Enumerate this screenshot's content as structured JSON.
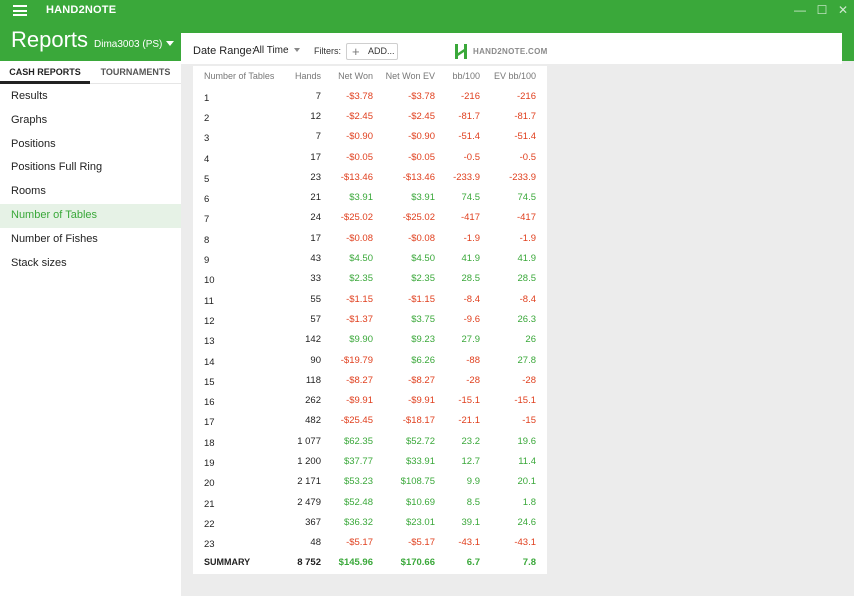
{
  "app": {
    "name": "HAND2NOTE"
  },
  "window_controls": {
    "minimize": "—",
    "maximize": "☐",
    "close": "✕"
  },
  "header": {
    "title": "Reports",
    "account": "Dima3003 (PS)"
  },
  "sidebar": {
    "tabs": [
      {
        "label": "CASH REPORTS",
        "active": true
      },
      {
        "label": "TOURNAMENTS",
        "active": false
      }
    ],
    "items": [
      {
        "label": "Results"
      },
      {
        "label": "Graphs"
      },
      {
        "label": "Positions"
      },
      {
        "label": "Positions Full Ring"
      },
      {
        "label": "Rooms"
      },
      {
        "label": "Number of Tables",
        "active": true
      },
      {
        "label": "Number of Fishes"
      },
      {
        "label": "Stack sizes"
      }
    ]
  },
  "filters": {
    "date_range_label": "Date Range:",
    "date_range_value": "All Time",
    "filters_label": "Filters:",
    "add_label": "ADD..."
  },
  "logo": {
    "text": "HAND2NOTE.COM"
  },
  "table": {
    "headers": [
      "Number of Tables",
      "Hands",
      "Net Won",
      "Net Won  EV",
      "bb/100",
      "EV bb/100"
    ],
    "rows": [
      [
        "1",
        "7",
        "-$3.78",
        "-$3.78",
        "-216",
        "-216"
      ],
      [
        "2",
        "12",
        "-$2.45",
        "-$2.45",
        "-81.7",
        "-81.7"
      ],
      [
        "3",
        "7",
        "-$0.90",
        "-$0.90",
        "-51.4",
        "-51.4"
      ],
      [
        "4",
        "17",
        "-$0.05",
        "-$0.05",
        "-0.5",
        "-0.5"
      ],
      [
        "5",
        "23",
        "-$13.46",
        "-$13.46",
        "-233.9",
        "-233.9"
      ],
      [
        "6",
        "21",
        "$3.91",
        "$3.91",
        "74.5",
        "74.5"
      ],
      [
        "7",
        "24",
        "-$25.02",
        "-$25.02",
        "-417",
        "-417"
      ],
      [
        "8",
        "17",
        "-$0.08",
        "-$0.08",
        "-1.9",
        "-1.9"
      ],
      [
        "9",
        "43",
        "$4.50",
        "$4.50",
        "41.9",
        "41.9"
      ],
      [
        "10",
        "33",
        "$2.35",
        "$2.35",
        "28.5",
        "28.5"
      ],
      [
        "11",
        "55",
        "-$1.15",
        "-$1.15",
        "-8.4",
        "-8.4"
      ],
      [
        "12",
        "57",
        "-$1.37",
        "$3.75",
        "-9.6",
        "26.3"
      ],
      [
        "13",
        "142",
        "$9.90",
        "$9.23",
        "27.9",
        "26"
      ],
      [
        "14",
        "90",
        "-$19.79",
        "$6.26",
        "-88",
        "27.8"
      ],
      [
        "15",
        "118",
        "-$8.27",
        "-$8.27",
        "-28",
        "-28"
      ],
      [
        "16",
        "262",
        "-$9.91",
        "-$9.91",
        "-15.1",
        "-15.1"
      ],
      [
        "17",
        "482",
        "-$25.45",
        "-$18.17",
        "-21.1",
        "-15"
      ],
      [
        "18",
        "1 077",
        "$62.35",
        "$52.72",
        "23.2",
        "19.6"
      ],
      [
        "19",
        "1 200",
        "$37.77",
        "$33.91",
        "12.7",
        "11.4"
      ],
      [
        "20",
        "2 171",
        "$53.23",
        "$108.75",
        "9.9",
        "20.1"
      ],
      [
        "21",
        "2 479",
        "$52.48",
        "$10.69",
        "8.5",
        "1.8"
      ],
      [
        "22",
        "367",
        "$36.32",
        "$23.01",
        "39.1",
        "24.6"
      ],
      [
        "23",
        "48",
        "-$5.17",
        "-$5.17",
        "-43.1",
        "-43.1"
      ]
    ],
    "summary": [
      "SUMMARY",
      "8 752",
      "$145.96",
      "$170.66",
      "6.7",
      "7.8"
    ]
  },
  "colors": {
    "accent": "#3aa83a",
    "positive": "#3aa83a",
    "negative": "#e0401f"
  }
}
